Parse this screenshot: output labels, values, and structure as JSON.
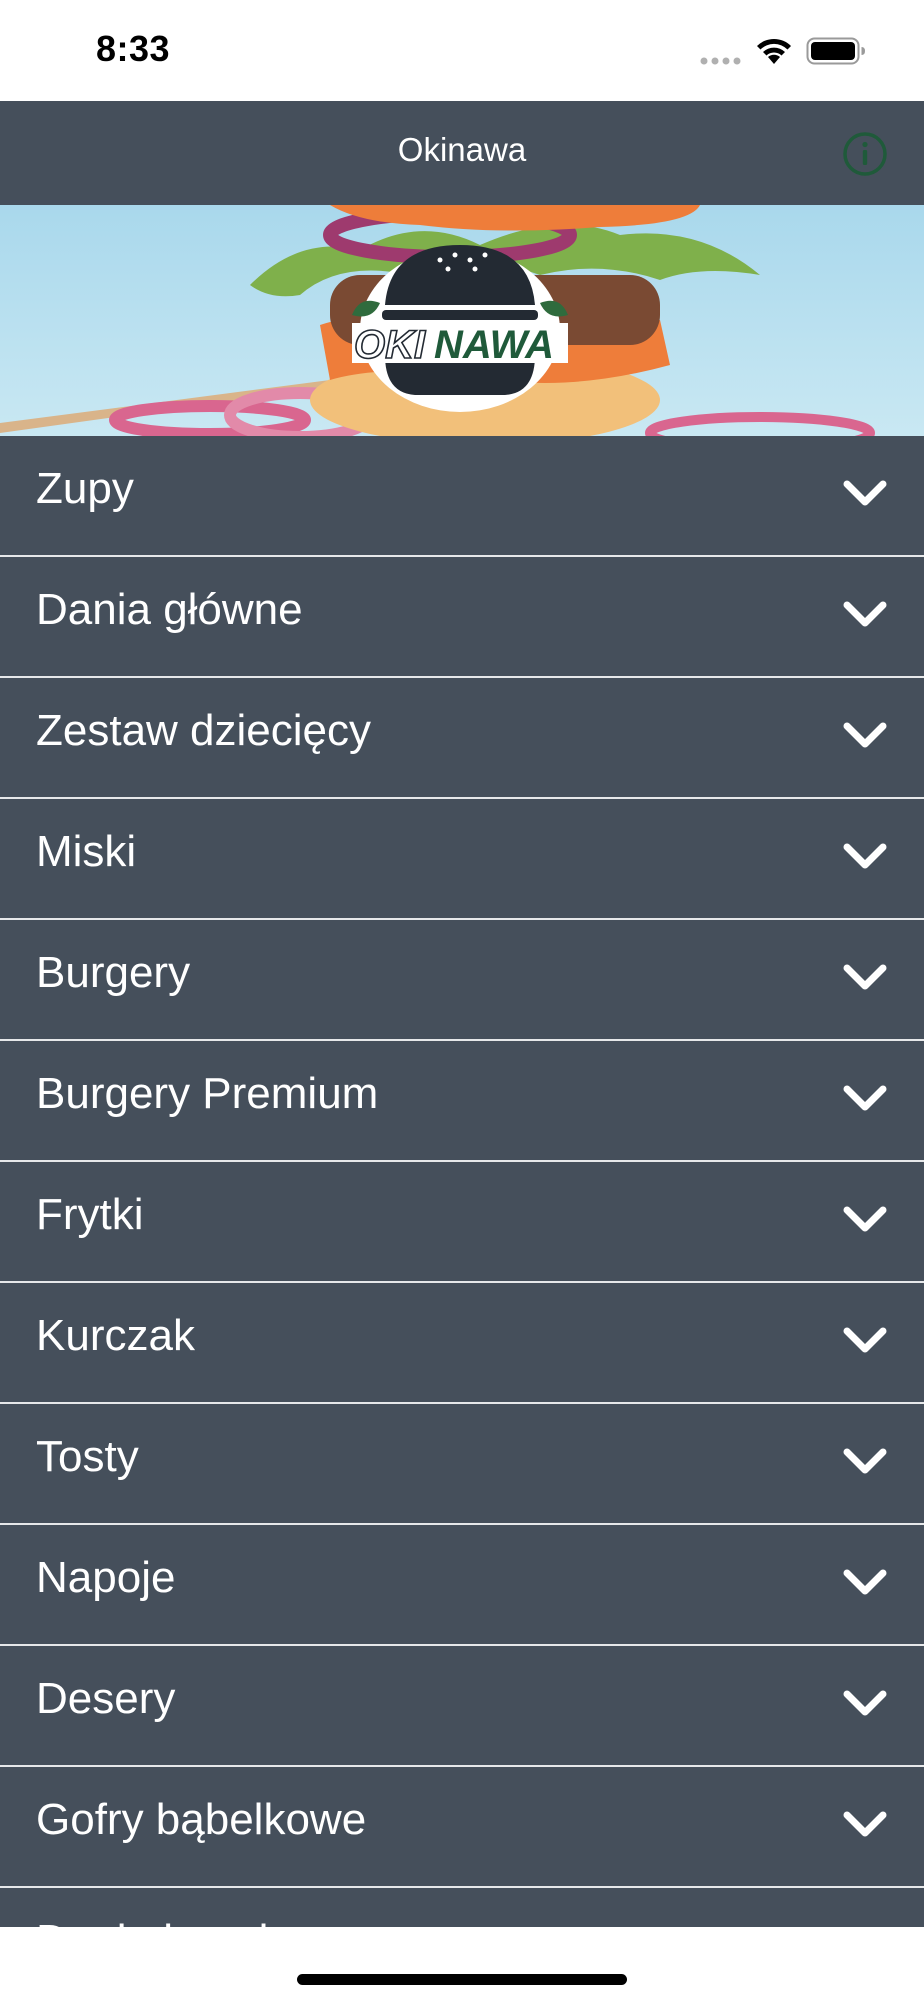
{
  "status_bar": {
    "time": "8:33"
  },
  "nav": {
    "title": "Okinawa",
    "info_icon": "info-circle-icon",
    "info_color": "#1f5a3a"
  },
  "banner": {
    "logo_text_left": "OKI",
    "logo_text_right": "NAWA"
  },
  "menu": {
    "chevron_icon": "chevron-down-icon",
    "items": [
      {
        "label": "Zupy"
      },
      {
        "label": "Dania główne"
      },
      {
        "label": "Zestaw dziecięcy"
      },
      {
        "label": "Miski"
      },
      {
        "label": "Burgery"
      },
      {
        "label": "Burgery Premium"
      },
      {
        "label": "Frytki"
      },
      {
        "label": "Kurczak"
      },
      {
        "label": "Tosty"
      },
      {
        "label": "Napoje"
      },
      {
        "label": "Desery"
      },
      {
        "label": "Gofry bąbelkowe"
      },
      {
        "label": "Dania bezglutenowe"
      }
    ]
  },
  "colors": {
    "nav_background": "#454f5b",
    "list_background": "#454f5b",
    "divider": "#e6e8ea",
    "text": "#ffffff"
  }
}
